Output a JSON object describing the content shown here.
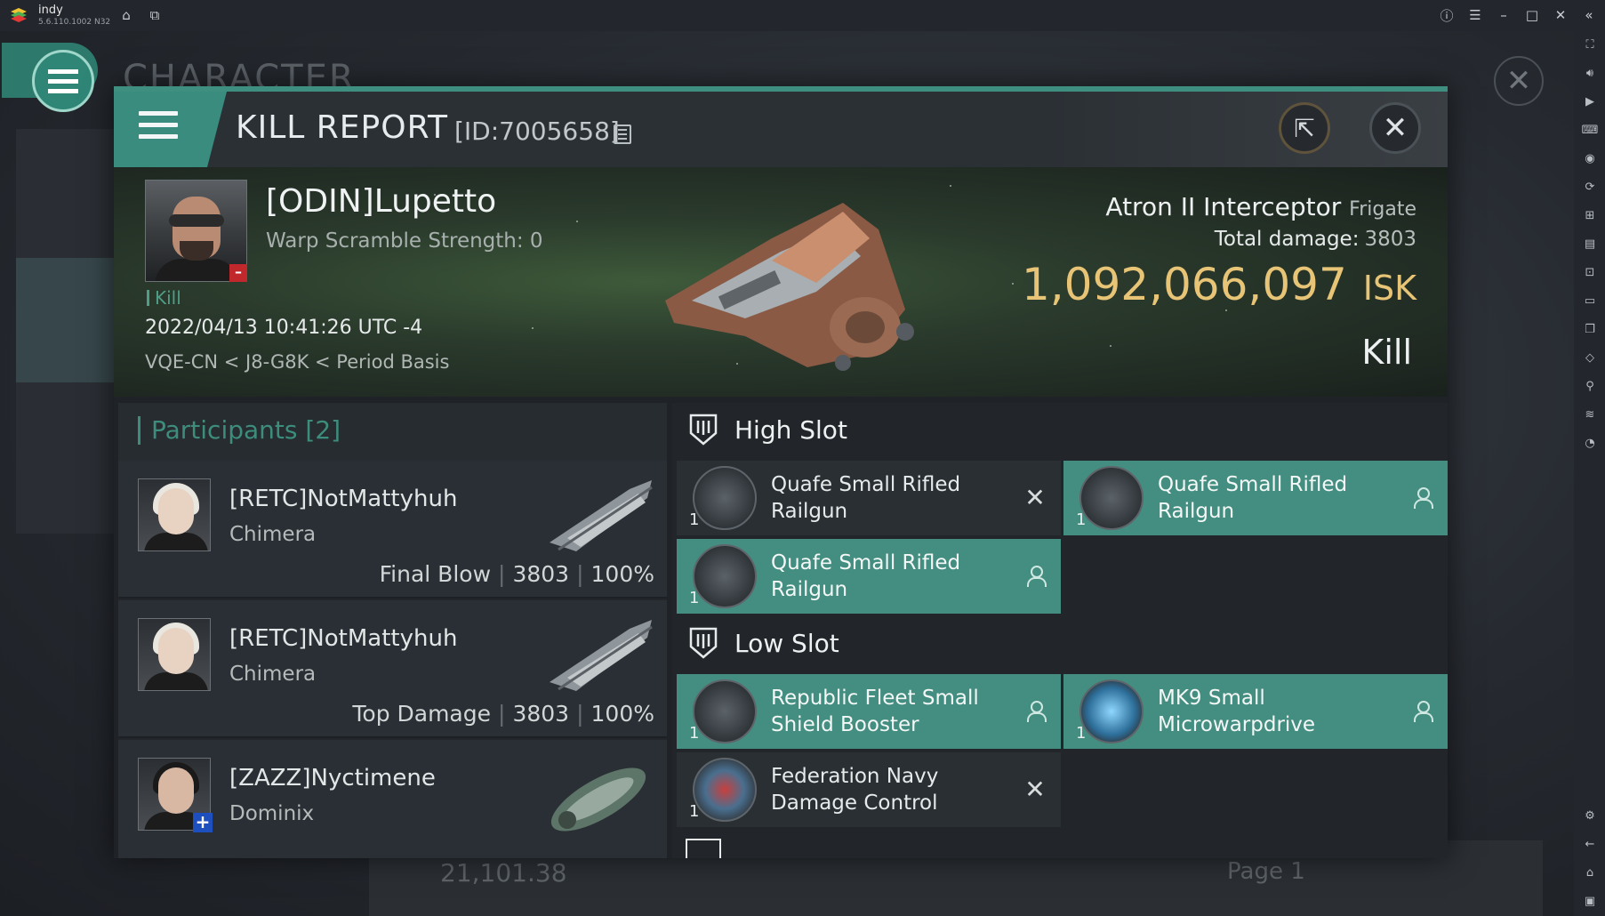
{
  "emulator": {
    "app_name": "indy",
    "app_version": "5.6.110.1002 N32"
  },
  "background": {
    "title": "CHARACTER",
    "pager_value": "21,101.38",
    "pager_page": "Page 1"
  },
  "header": {
    "title": "KILL REPORT",
    "id": "[ID:7005658]"
  },
  "victim": {
    "name": "[ODIN]Lupetto",
    "warp_scramble": "Warp Scramble Strength: 0",
    "kill_tag": "Kill",
    "datetime": "2022/04/13 10:41:26 UTC -4",
    "location": "VQE-CN < J8-G8K < Period Basis",
    "ship_name": "Atron II Interceptor",
    "ship_class": "Frigate",
    "total_damage_label": "Total damage:",
    "total_damage_value": "3803",
    "isk_value": "1,092,066,097",
    "isk_unit": "ISK",
    "result": "Kill"
  },
  "participants": {
    "title": "Participants",
    "count": "[2]",
    "rows": [
      {
        "name": "[RETC]NotMattyhuh",
        "ship": "Chimera",
        "role": "Final Blow",
        "damage": "3803",
        "percent": "100%"
      },
      {
        "name": "[RETC]NotMattyhuh",
        "ship": "Chimera",
        "role": "Top Damage",
        "damage": "3803",
        "percent": "100%"
      },
      {
        "name": "[ZAZZ]Nyctimene",
        "ship": "Dominix",
        "role": "",
        "damage": "",
        "percent": ""
      }
    ]
  },
  "fitting": {
    "high_slot_label": "High Slot",
    "low_slot_label": "Low Slot",
    "high": [
      {
        "qty": "1",
        "name": "Quafe Small Rifled Railgun",
        "status": "destroyed"
      },
      {
        "qty": "1",
        "name": "Quafe Small Rifled Railgun",
        "status": "dropped"
      },
      {
        "qty": "1",
        "name": "Quafe Small Rifled Railgun",
        "status": "dropped"
      }
    ],
    "low": [
      {
        "qty": "1",
        "name": "Republic Fleet Small Shield Booster",
        "status": "dropped"
      },
      {
        "qty": "1",
        "name": "MK9 Small Microwarpdrive",
        "status": "dropped"
      },
      {
        "qty": "1",
        "name": "Federation Navy Damage Control",
        "status": "destroyed"
      }
    ]
  }
}
